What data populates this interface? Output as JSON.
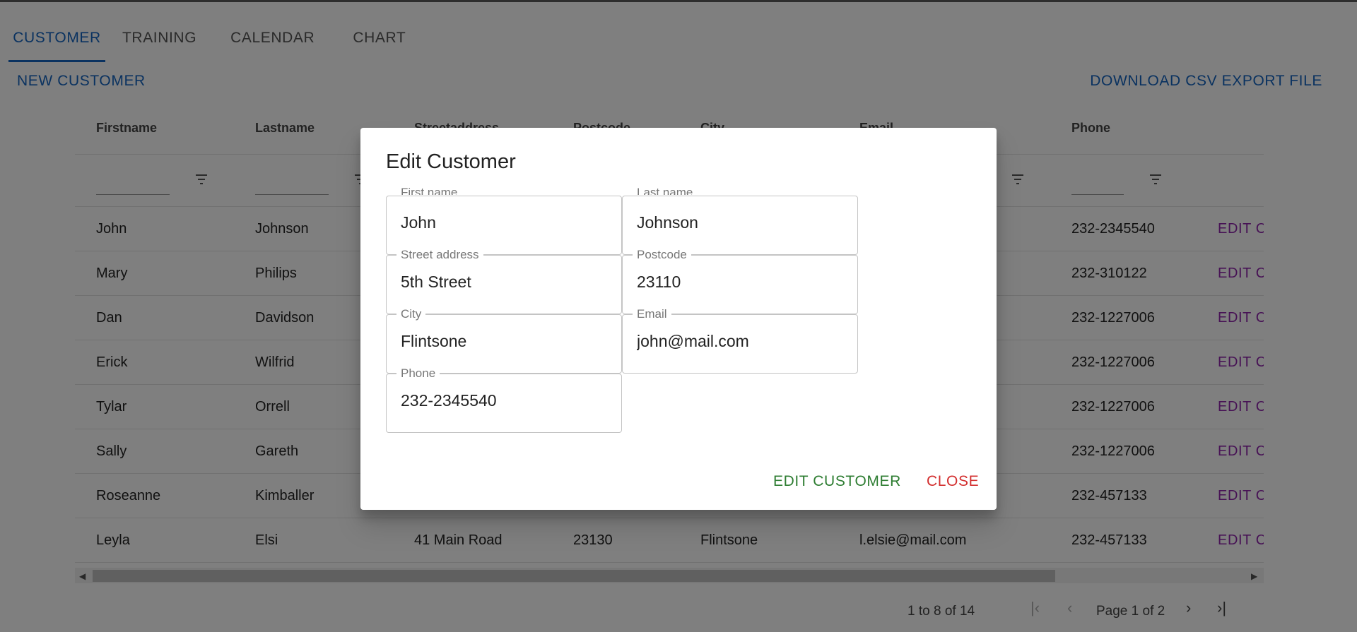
{
  "tabs": [
    {
      "label": "CUSTOMER"
    },
    {
      "label": "TRAINING"
    },
    {
      "label": "CALENDAR"
    },
    {
      "label": "CHART"
    }
  ],
  "actions": {
    "new_customer": "NEW CUSTOMER",
    "download_csv": "DOWNLOAD CSV EXPORT FILE"
  },
  "grid": {
    "headers": [
      "Firstname",
      "Lastname",
      "Streetaddress",
      "Postcode",
      "City",
      "Email",
      "Phone"
    ],
    "edit_label": "EDIT C",
    "rows": [
      {
        "firstname": "John",
        "lastname": "Johnson",
        "streetaddress": "",
        "postcode": "",
        "city": "",
        "email": "",
        "phone": "232-2345540"
      },
      {
        "firstname": "Mary",
        "lastname": "Philips",
        "streetaddress": "",
        "postcode": "",
        "city": "",
        "email": "",
        "phone": "232-310122"
      },
      {
        "firstname": "Dan",
        "lastname": "Davidson",
        "streetaddress": "",
        "postcode": "",
        "city": "",
        "email": "",
        "phone": "232-1227006"
      },
      {
        "firstname": "Erick",
        "lastname": "Wilfrid",
        "streetaddress": "",
        "postcode": "",
        "city": "",
        "email": "",
        "phone": "232-1227006"
      },
      {
        "firstname": "Tylar",
        "lastname": "Orrell",
        "streetaddress": "",
        "postcode": "",
        "city": "",
        "email": "",
        "phone": "232-1227006"
      },
      {
        "firstname": "Sally",
        "lastname": "Gareth",
        "streetaddress": "",
        "postcode": "",
        "city": "",
        "email": "",
        "phone": "232-1227006"
      },
      {
        "firstname": "Roseanne",
        "lastname": "Kimballer",
        "streetaddress": "",
        "postcode": "",
        "city": "",
        "email": "",
        "phone": "232-457133"
      },
      {
        "firstname": "Leyla",
        "lastname": "Elsi",
        "streetaddress": "41 Main Road",
        "postcode": "23130",
        "city": "Flintsone",
        "email": "l.elsie@mail.com",
        "phone": "232-457133"
      }
    ]
  },
  "pagination": {
    "range": "1 to 8 of 14",
    "page": "Page 1 of 2"
  },
  "dialog": {
    "title": "Edit Customer",
    "fields": {
      "firstname": {
        "label": "First name",
        "value": "John"
      },
      "lastname": {
        "label": "Last name",
        "value": "Johnson"
      },
      "streetaddress": {
        "label": "Street address",
        "value": "5th Street"
      },
      "postcode": {
        "label": "Postcode",
        "value": "23110"
      },
      "city": {
        "label": "City",
        "value": "Flintsone"
      },
      "email": {
        "label": "Email",
        "value": "john@mail.com"
      },
      "phone": {
        "label": "Phone",
        "value": "232-2345540"
      }
    },
    "edit_button": "EDIT CUSTOMER",
    "close_button": "CLOSE"
  },
  "colors": {
    "primary": "#1565c0",
    "edit_link": "#8e24aa",
    "confirm": "#2e7d32",
    "danger": "#d32f2f"
  }
}
